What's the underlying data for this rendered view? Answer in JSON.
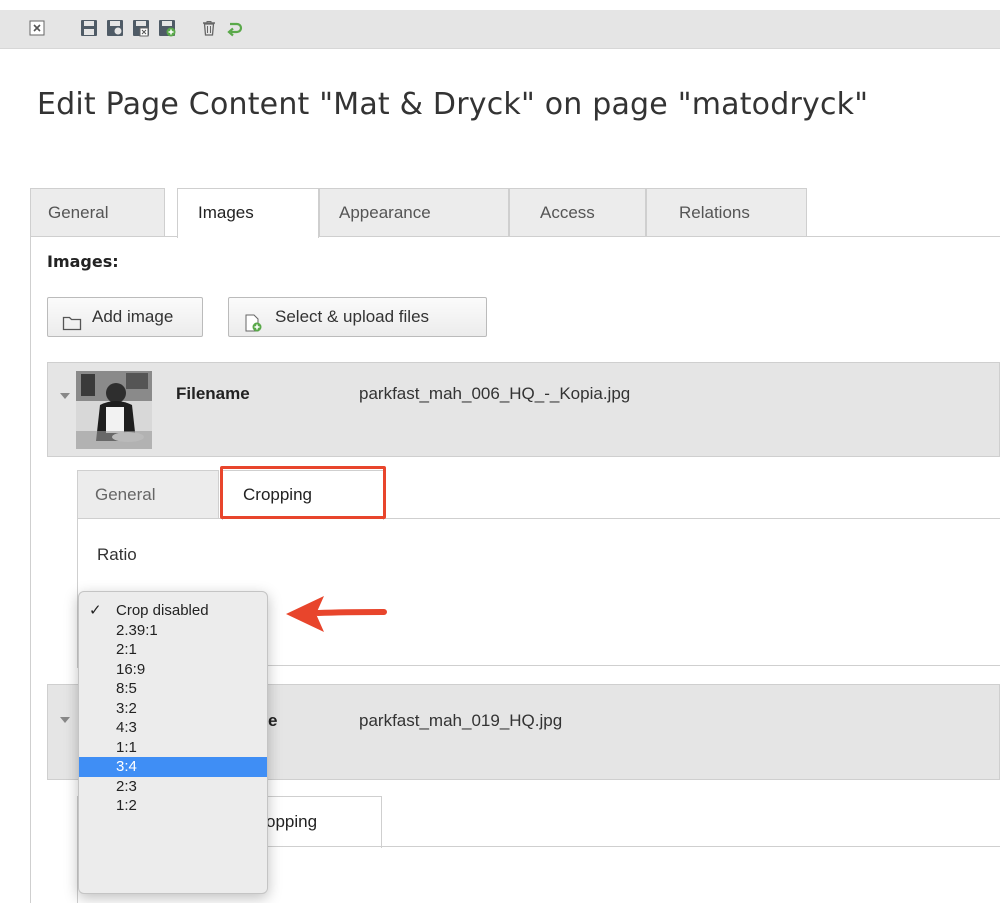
{
  "toolbar": {
    "icons": [
      "close-icon",
      "save-icon",
      "save-view-icon",
      "save-close-icon",
      "save-new-icon",
      "delete-icon",
      "undo-icon"
    ]
  },
  "page_title": "Edit Page Content \"Mat & Dryck\" on page \"matodryck\"",
  "tabs": [
    {
      "label": "General"
    },
    {
      "label": "Images"
    },
    {
      "label": "Appearance"
    },
    {
      "label": "Access"
    },
    {
      "label": "Relations"
    }
  ],
  "active_tab": "Images",
  "images_section": {
    "label": "Images:",
    "add_image_label": "Add image",
    "upload_label": "Select & upload files"
  },
  "files": [
    {
      "filename_label": "Filename",
      "filename": "parkfast_mah_006_HQ_-_Kopia.jpg",
      "inner_tabs": [
        {
          "label": "General"
        },
        {
          "label": "Cropping"
        }
      ],
      "active_inner_tab": "Cropping",
      "ratio_label": "Ratio"
    },
    {
      "filename_label": "e",
      "filename": "parkfast_mah_019_HQ.jpg",
      "inner_tab_partial": "opping"
    }
  ],
  "ratio_dropdown": {
    "options": [
      "Crop disabled",
      "2.39:1",
      "2:1",
      "16:9",
      "8:5",
      "3:2",
      "4:3",
      "1:1",
      "3:4",
      "2:3",
      "1:2"
    ],
    "checked": "Crop disabled",
    "highlighted": "3:4",
    "check_mark": "✓"
  },
  "colors": {
    "annotation_red": "#e8452c",
    "selection_blue": "#3f8ef5",
    "toolbar_bg": "#e5e5e5"
  }
}
